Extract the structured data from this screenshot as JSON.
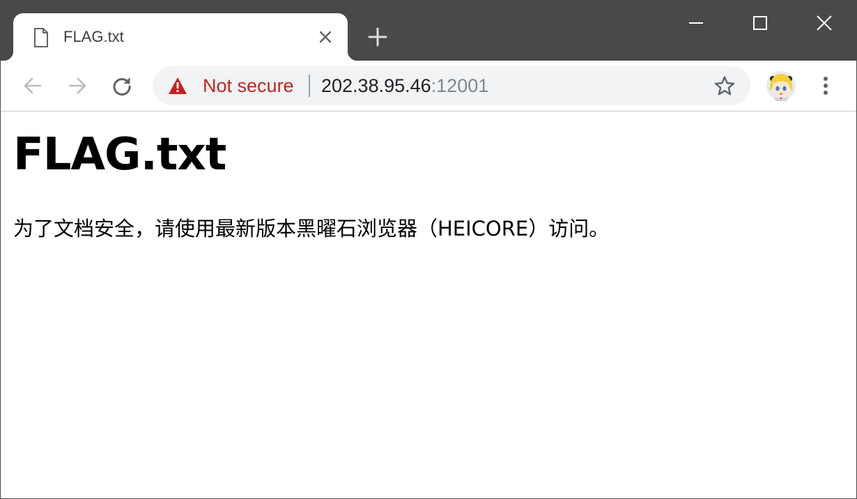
{
  "tab": {
    "title": "FLAG.txt",
    "icon": "file-icon"
  },
  "toolbar": {
    "security_label": "Not secure",
    "url_host": "202.38.95.46",
    "url_port": ":12001"
  },
  "page": {
    "heading": "FLAG.txt",
    "message": "为了文档安全，请使用最新版本黑曜石浏览器（HEICORE）访问。"
  },
  "colors": {
    "tabstrip": "#4a4948",
    "security_warning": "#c5221f",
    "omnibox_bg": "#f1f3f4"
  }
}
